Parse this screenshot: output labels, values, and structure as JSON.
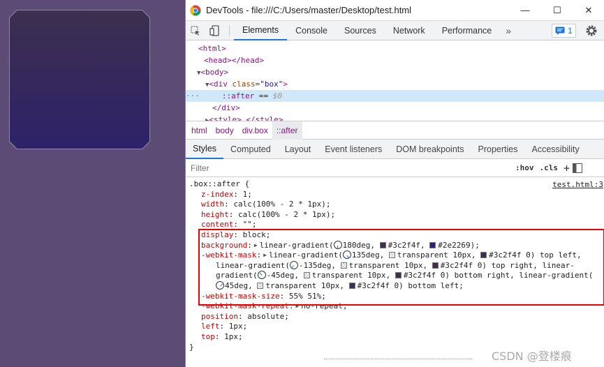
{
  "window": {
    "title": "DevTools - file:///C:/Users/master/Desktop/test.html",
    "minimize_glyph": "—",
    "maximize_glyph": "☐",
    "close_glyph": "✕"
  },
  "toolbar": {
    "tabs": [
      "Elements",
      "Console",
      "Sources",
      "Network",
      "Performance"
    ],
    "more": "»",
    "issues_count": "1",
    "icons": [
      "inspect-icon",
      "device-toggle-icon",
      "issues-icon",
      "gear-icon"
    ]
  },
  "elements_tree": {
    "l1": "<html>",
    "l2": "<head></head>",
    "l3": "<body>",
    "l4_open": "<div ",
    "l4_attr": "class",
    "l4_val": "\"box\"",
    "l4_close": ">",
    "l5_dots": "···",
    "l5_text": "::after",
    "l5_eq": " == ",
    "l5_ref": "$0",
    "l6": "</div>",
    "l7": "<style>…</style>"
  },
  "breadcrumbs": [
    "html",
    "body",
    "div.box",
    "::after"
  ],
  "subtabs": [
    "Styles",
    "Computed",
    "Layout",
    "Event listeners",
    "DOM breakpoints",
    "Properties",
    "Accessibility"
  ],
  "filter": {
    "placeholder": "Filter",
    "hov": ":hov",
    "cls": ".cls",
    "plus": "+"
  },
  "styles": {
    "selector": ".box::after {",
    "source": "test.html:3",
    "zindex_prop": "z-index",
    "zindex_val": " 1;",
    "width_prop": "width",
    "width_val": " calc(100% - 2 * 1px);",
    "height_prop": "height",
    "height_val": " calc(100% - 2 * 1px);",
    "content_prop": "content",
    "content_val": " \"\";",
    "display_prop": "display",
    "display_val": " block;",
    "bg_prop": "background",
    "bg_fn": "linear-gradient(",
    "bg_a": "180deg, ",
    "bg_c1": "#3c2f4f",
    "bg_c2": "#2e2269",
    "bg_end": ");",
    "mask_prop": "-webkit-mask",
    "mask_l1_fn": "linear-gradient(",
    "mask_l1_a": "135deg, ",
    "mask_l1_t": "transparent 10px, ",
    "mask_l1_c": "#3c2f4f 0) top left,",
    "mask_l2_fn": "linear-gradient(",
    "mask_l2_a": "-135deg, ",
    "mask_l2_t": "transparent 10px, ",
    "mask_l2_c": "#3c2f4f 0) top right, linear-",
    "mask_l3_fn": "gradient(",
    "mask_l3_a": "-45deg, ",
    "mask_l3_t": "transparent 10px, ",
    "mask_l3_c": "#3c2f4f 0) bottom right, linear-gradient(",
    "mask_l4_a": "45deg, ",
    "mask_l4_t": "transparent 10px, ",
    "mask_l4_c": "#3c2f4f 0) bottom left;",
    "masksize_prop": "-webkit-mask-size",
    "masksize_val": " 55% 51%;",
    "maskrepeat_prop": "-webkit-mask-repeat",
    "maskrepeat_val": "no-repeat;",
    "position_prop": "position",
    "position_val": " absolute;",
    "left_prop": "left",
    "left_val": " 1px;",
    "top_prop": "top",
    "top_val": " 1px;",
    "close": "}"
  },
  "colors": {
    "page_bg": "#5b4b75",
    "box_top": "#3c2f4f",
    "box_bottom": "#2e2269",
    "accent": "#1a73e8",
    "highlight": "#e00000"
  },
  "watermark": "CSDN @登楼痕"
}
